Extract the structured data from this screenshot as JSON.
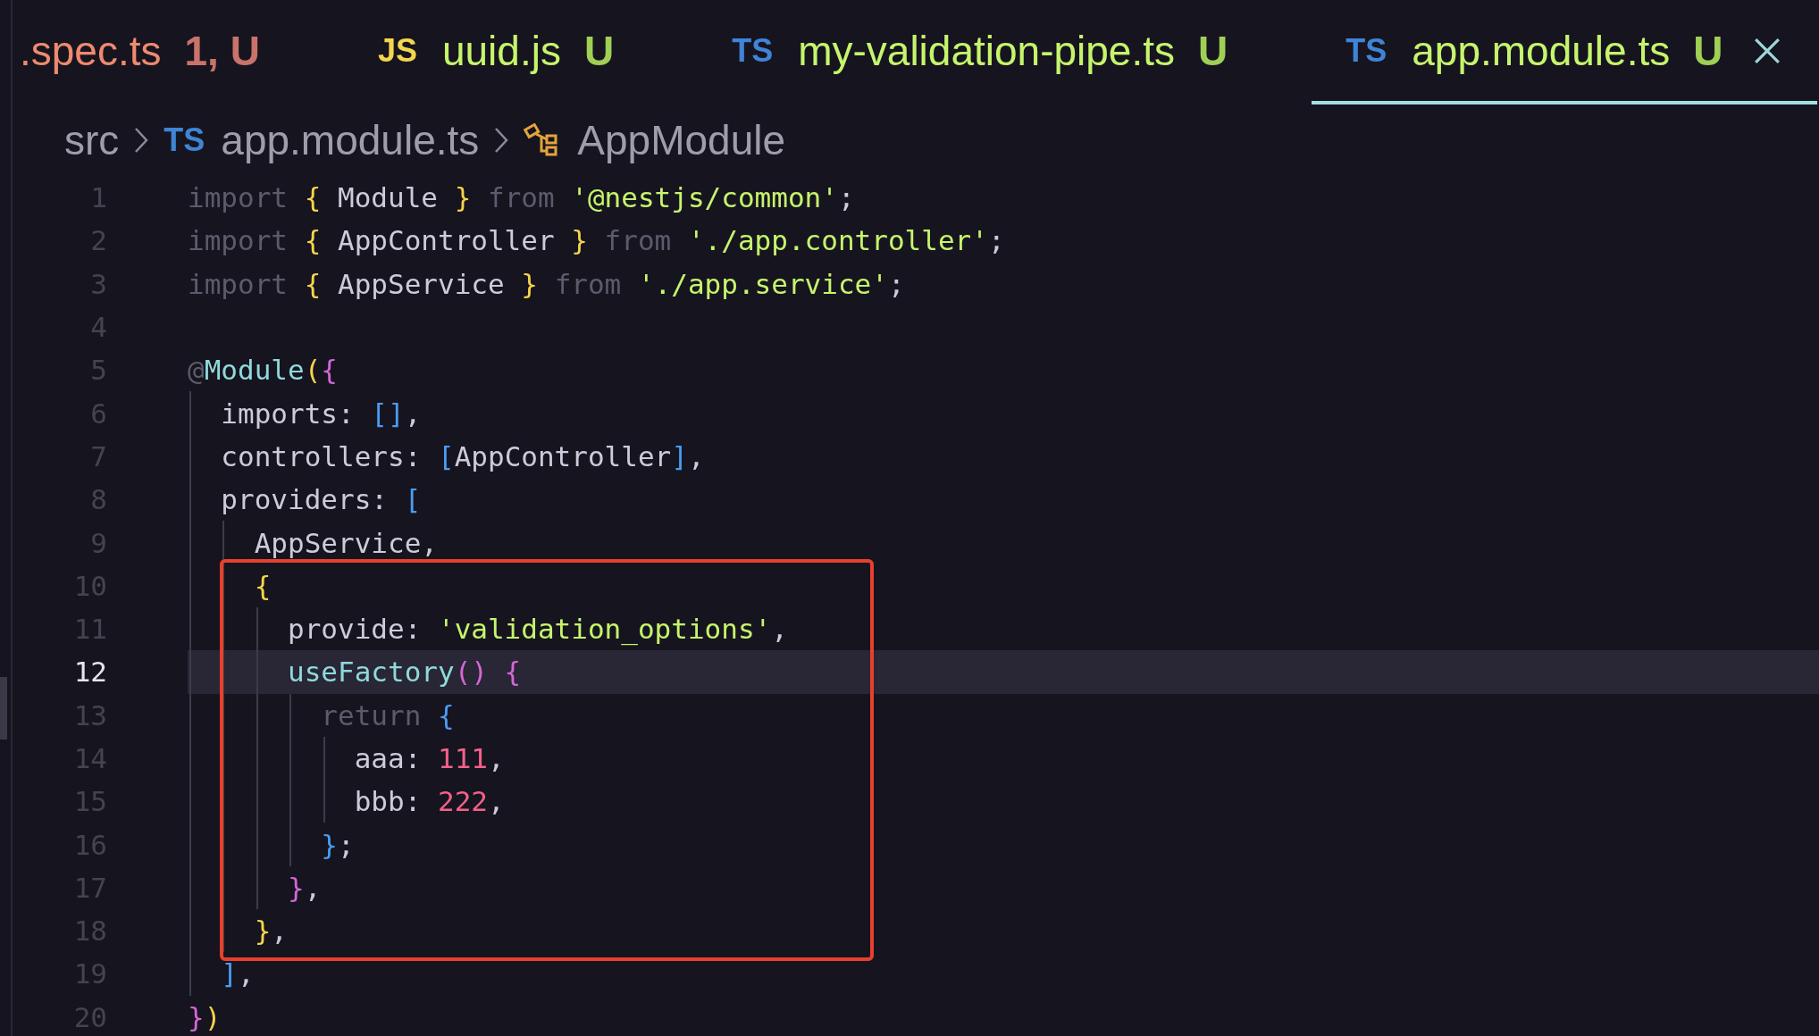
{
  "tabs": [
    {
      "name": ".spec.ts",
      "status": "1, U",
      "has_errors": true,
      "selected": false
    },
    {
      "icon": "JS",
      "name": "uuid.js",
      "status": "U",
      "has_errors": false,
      "selected": false
    },
    {
      "icon": "TS",
      "name": "my-validation-pipe.ts",
      "status": "U",
      "has_errors": false,
      "selected": false
    },
    {
      "icon": "TS",
      "name": "app.module.ts",
      "status": "U",
      "has_errors": false,
      "selected": true
    }
  ],
  "breadcrumb": [
    {
      "kind": "folder",
      "label": "src"
    },
    {
      "kind": "file",
      "icon": "TS",
      "label": "app.module.ts"
    },
    {
      "kind": "symbol",
      "label": "AppModule"
    }
  ],
  "code": [
    {
      "kind": "plain",
      "lines": [
        {
          "number": "1",
          "current": false,
          "tokens": [
            {
              "kind": "keyword",
              "text": "import "
            },
            {
              "kind": "bracket1",
              "text": "{ "
            },
            {
              "kind": "text",
              "text": "Module "
            },
            {
              "kind": "bracket1",
              "text": "} "
            },
            {
              "kind": "keyword",
              "text": "from "
            },
            {
              "kind": "string",
              "text": "'@nestjs/common'"
            },
            {
              "kind": "text",
              "text": ";"
            }
          ]
        },
        {
          "number": "2",
          "current": false,
          "tokens": [
            {
              "kind": "keyword",
              "text": "import "
            },
            {
              "kind": "bracket1",
              "text": "{ "
            },
            {
              "kind": "text",
              "text": "AppController "
            },
            {
              "kind": "bracket1",
              "text": "} "
            },
            {
              "kind": "keyword",
              "text": "from "
            },
            {
              "kind": "string",
              "text": "'./app.controller'"
            },
            {
              "kind": "text",
              "text": ";"
            }
          ]
        },
        {
          "number": "3",
          "current": false,
          "tokens": [
            {
              "kind": "keyword",
              "text": "import "
            },
            {
              "kind": "bracket1",
              "text": "{ "
            },
            {
              "kind": "text",
              "text": "AppService "
            },
            {
              "kind": "bracket1",
              "text": "} "
            },
            {
              "kind": "keyword",
              "text": "from "
            },
            {
              "kind": "string",
              "text": "'./app.service'"
            },
            {
              "kind": "text",
              "text": ";"
            }
          ]
        },
        {
          "number": "4",
          "current": false
        },
        {
          "number": "5",
          "current": false,
          "tokens": [
            {
              "kind": "keyword",
              "text": "@"
            },
            {
              "kind": "func",
              "text": "Module"
            },
            {
              "kind": "bracket1",
              "text": "("
            },
            {
              "kind": "bracket2",
              "text": "{"
            }
          ]
        },
        {
          "number": "6",
          "current": false,
          "tokens": [
            {
              "kind": "text",
              "text": "  imports: "
            },
            {
              "kind": "bracket3",
              "text": "[]"
            },
            {
              "kind": "text",
              "text": ","
            }
          ]
        },
        {
          "number": "7",
          "current": false,
          "tokens": [
            {
              "kind": "text",
              "text": "  controllers: "
            },
            {
              "kind": "bracket3",
              "text": "["
            },
            {
              "kind": "text",
              "text": "AppController"
            },
            {
              "kind": "bracket3",
              "text": "]"
            },
            {
              "kind": "text",
              "text": ","
            }
          ]
        },
        {
          "number": "8",
          "current": false,
          "tokens": [
            {
              "kind": "text",
              "text": "  providers: "
            },
            {
              "kind": "bracket3",
              "text": "["
            }
          ]
        },
        {
          "number": "9",
          "current": false,
          "tokens": [
            {
              "kind": "text",
              "text": "    AppService,"
            }
          ]
        }
      ]
    },
    {
      "kind": "boxed",
      "lines": [
        {
          "number": "10",
          "current": false,
          "tokens": [
            {
              "kind": "bracket1",
              "text": "    {"
            }
          ]
        },
        {
          "number": "11",
          "current": false,
          "tokens": [
            {
              "kind": "text",
              "text": "      provide: "
            },
            {
              "kind": "string",
              "text": "'validation_options'"
            },
            {
              "kind": "text",
              "text": ","
            }
          ]
        },
        {
          "number": "12",
          "current": true,
          "tokens": [
            {
              "kind": "func",
              "text": "      useFactory"
            },
            {
              "kind": "bracket2",
              "text": "() {"
            }
          ]
        },
        {
          "number": "13",
          "current": false,
          "tokens": [
            {
              "kind": "keyword",
              "text": "        return "
            },
            {
              "kind": "bracket3",
              "text": "{"
            }
          ]
        },
        {
          "number": "14",
          "current": false,
          "tokens": [
            {
              "kind": "text",
              "text": "          aaa: "
            },
            {
              "kind": "number",
              "text": "111"
            },
            {
              "kind": "text",
              "text": ","
            }
          ]
        },
        {
          "number": "15",
          "current": false,
          "tokens": [
            {
              "kind": "text",
              "text": "          bbb: "
            },
            {
              "kind": "number",
              "text": "222"
            },
            {
              "kind": "text",
              "text": ","
            }
          ]
        },
        {
          "number": "16",
          "current": false,
          "tokens": [
            {
              "kind": "bracket3",
              "text": "        }"
            },
            {
              "kind": "text",
              "text": ";"
            }
          ]
        },
        {
          "number": "17",
          "current": false,
          "tokens": [
            {
              "kind": "bracket2",
              "text": "      }"
            },
            {
              "kind": "text",
              "text": ","
            }
          ]
        },
        {
          "number": "18",
          "current": false,
          "tokens": [
            {
              "kind": "bracket1",
              "text": "    }"
            },
            {
              "kind": "text",
              "text": ","
            }
          ]
        }
      ]
    },
    {
      "kind": "plain",
      "lines": [
        {
          "number": "19",
          "current": false,
          "tokens": [
            {
              "kind": "bracket3",
              "text": "  ]"
            },
            {
              "kind": "text",
              "text": ","
            }
          ]
        },
        {
          "number": "20",
          "current": false,
          "tokens": [
            {
              "kind": "bracket2",
              "text": "}"
            },
            {
              "kind": "bracket1",
              "text": ")"
            }
          ]
        }
      ]
    }
  ]
}
